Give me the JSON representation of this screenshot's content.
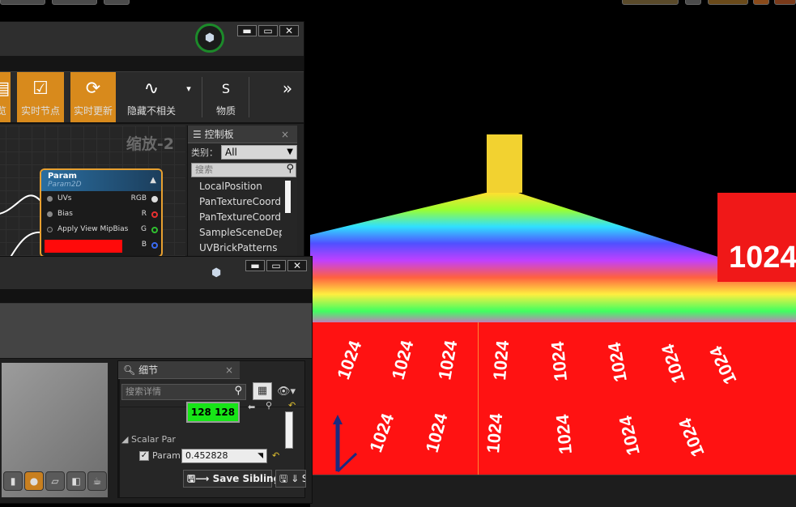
{
  "material_editor": {
    "window_buttons": [
      "▬",
      "▭",
      "✕"
    ],
    "toolbar": {
      "items": [
        {
          "label": "览",
          "icon": "preview-icon",
          "active": true
        },
        {
          "label": "实时节点",
          "icon": "live-nodes-icon",
          "active": true
        },
        {
          "label": "实时更新",
          "icon": "live-update-icon",
          "active": true
        },
        {
          "label": "隐藏不相关",
          "icon": "hide-unrelated-icon",
          "active": false
        },
        {
          "label": "物质",
          "icon": "substance-icon",
          "active": false
        }
      ],
      "more": "»"
    },
    "graph": {
      "zoom_label": "缩放-2",
      "node": {
        "title": "Param",
        "subtitle": "Param2D",
        "inputs": [
          "UVs",
          "Bias",
          "Apply View MipBias"
        ],
        "outputs": [
          "RGB",
          "R",
          "G",
          "B"
        ],
        "output_colors": [
          "#dddddd",
          "#e83030",
          "#30c030",
          "#3a6af0"
        ]
      }
    },
    "palette": {
      "tab_label": "控制板",
      "close": "×",
      "category_label": "类别：",
      "category_value": "All",
      "search_placeholder": "搜索",
      "items": [
        "LocalPosition",
        "PanTextureCoordi",
        "PanTextureCoordi",
        "SampleSceneDept",
        "UVBrickPatterns"
      ]
    }
  },
  "instance_editor": {
    "window_buttons": [
      "▬",
      "▭",
      "✕"
    ],
    "details": {
      "tab_label": "细节",
      "close": "×",
      "search_placeholder": "搜索详情",
      "swatch_text": "128  128",
      "group_label": "Scalar Par",
      "param_label": "Param",
      "param_value": "0.452828",
      "save_sibling_label": "Save Sibling",
      "save_child_label": "⇓ S"
    }
  },
  "scene": {
    "texture_text": "1024",
    "colors": {
      "red": "#ff1212",
      "background": "#000000",
      "accent": "#d88a1c",
      "ue_ring": "#1c8a2a"
    }
  }
}
